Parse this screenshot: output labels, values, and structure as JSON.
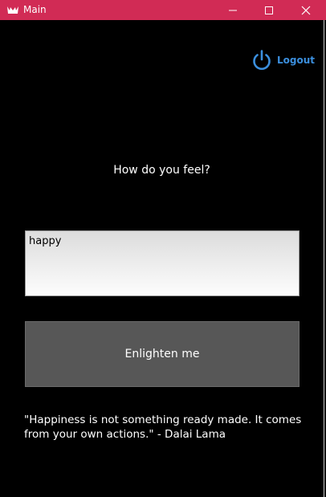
{
  "window": {
    "title": "Main",
    "titlebar_color": "#d12b55",
    "icons": [
      "app-icon",
      "minimize-icon",
      "maximize-icon",
      "close-icon"
    ]
  },
  "logout": {
    "label": "Logout",
    "icon": "power-icon",
    "color": "#3b8fde"
  },
  "main": {
    "prompt": "How do you feel?",
    "feeling_input_value": "happy",
    "submit_label": "Enlighten me",
    "quote": "\"Happiness is not something ready made. It comes from your own actions.\" - Dalai Lama"
  }
}
